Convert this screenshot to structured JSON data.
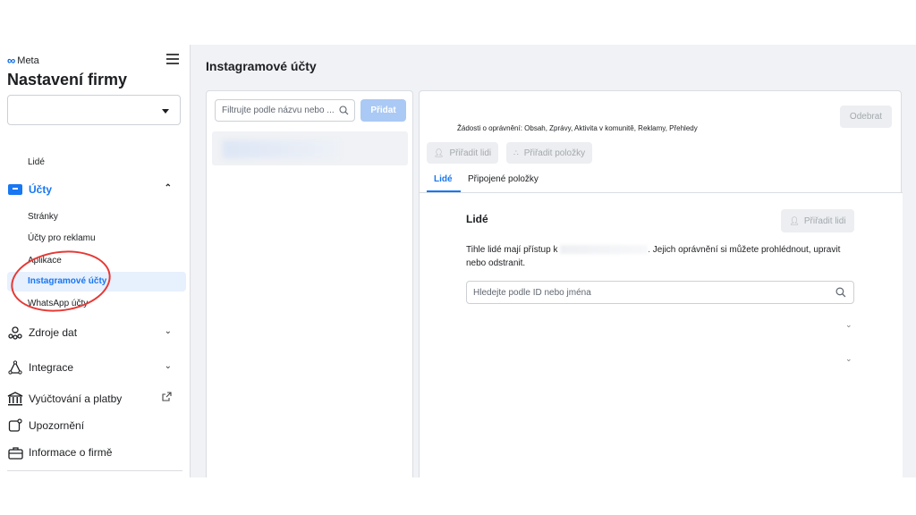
{
  "sidebar": {
    "brand": "Meta",
    "title": "Nastavení firmy",
    "items_top": [
      {
        "label": "Lidé"
      }
    ],
    "accounts_section": {
      "label": "Účty",
      "icon": "accounts-box-icon"
    },
    "accounts_items": [
      {
        "label": "Stránky"
      },
      {
        "label": "Účty pro reklamu"
      },
      {
        "label": "Aplikace"
      },
      {
        "label": "Instagramové účty",
        "active": true
      },
      {
        "label": "WhatsApp účty"
      }
    ],
    "main_items": [
      {
        "label": "Zdroje dat",
        "icon": "data-sources-icon"
      },
      {
        "label": "Integrace",
        "icon": "integrations-icon"
      },
      {
        "label": "Vyúčtování a platby",
        "icon": "billing-bank-icon"
      },
      {
        "label": "Upozornění",
        "icon": "notifications-icon"
      },
      {
        "label": "Informace o firmě",
        "icon": "briefcase-icon"
      }
    ]
  },
  "main": {
    "title": "Instagramové účty",
    "filter_placeholder": "Filtrujte podle názvu nebo ...",
    "add_button": "Přidat",
    "detail": {
      "remove_button": "Odebrat",
      "permissions_text": "Žádosti o oprávnění: Obsah, Zprávy, Aktivita v komunitě, Reklamy, Přehledy",
      "assign_people_button": "Přiřadit lidi",
      "assign_items_button": "Přiřadit položky",
      "tabs": [
        {
          "label": "Lidé",
          "active": true
        },
        {
          "label": "Připojené položky"
        }
      ],
      "section_title": "Lidé",
      "section_assign_button": "Přiřadit lidi",
      "description_before": "Tihle lidé mají přístup k",
      "description_after": ". Jejich oprávnění si můžete prohlédnout, upravit nebo odstranit.",
      "search_placeholder": "Hledejte podle ID nebo jména"
    }
  },
  "colors": {
    "accent": "#1877f2",
    "annotation": "#e53935",
    "background": "#f0f2f5"
  }
}
